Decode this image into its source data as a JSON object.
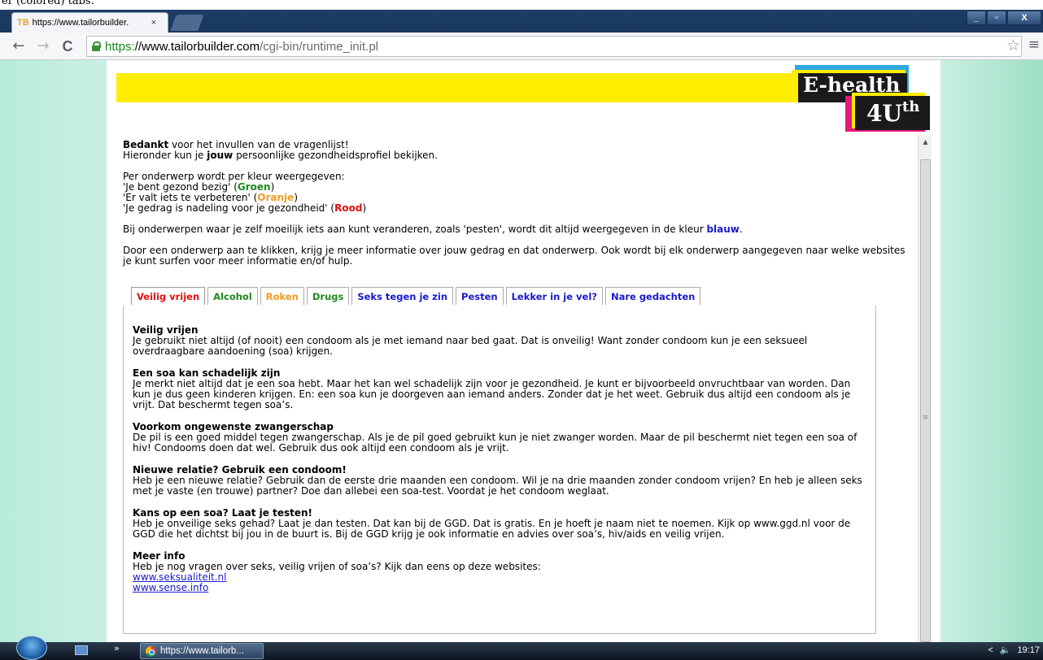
{
  "page_top_text": "er (colored) tabs.",
  "browser": {
    "tab_favicon": "TB",
    "tab_title": "https://www.tailorbuilder.",
    "tab_close": "×",
    "window_buttons": {
      "minimize": "_",
      "maximize": "▫",
      "close": "X"
    },
    "nav": {
      "back": "←",
      "forward": "→",
      "reload": "C"
    },
    "url": {
      "scheme": "https:",
      "host": "//www.tailorbuilder.com",
      "path": "/cgi-bin/runtime_init.pl"
    },
    "star": "☆",
    "menu": "≡"
  },
  "logo": {
    "line1": "E-health",
    "line2": "4U",
    "line2_sup": "th"
  },
  "intro": {
    "bedankt": "Bedankt",
    "line1_rest": " voor het invullen van de vragenlijst!",
    "line2_a": "Hieronder kun je ",
    "line2_bold": "jouw",
    "line2_b": " persoonlijke gezondheidsprofiel bekijken."
  },
  "legend": {
    "heading": "Per onderwerp wordt per kleur weergegeven:",
    "green_pre": "'Je bent gezond bezig' (",
    "green_word": "Groen",
    "orange_pre": "'Er valt iets te verbeteren' (",
    "orange_word": "Oranje",
    "red_pre": "'Je gedrag is nadeling voor je gezondheid' (",
    "red_word": "Rood",
    "close_paren": ")"
  },
  "blue_note": {
    "pre": "Bij onderwerpen waar je zelf moeilijk iets aan kunt veranderen, zoals 'pesten', wordt dit altijd weergegeven in de kleur ",
    "word": "blauw",
    "post": "."
  },
  "click_note": "Door een onderwerp aan te klikken, krijg je meer informatie over jouw gedrag en dat onderwerp. Ook wordt bij elk onderwerp aangegeven naar welke websites je kunt surfen voor meer informatie en/of hulp.",
  "topic_tabs": [
    {
      "label": "Veilig vrijen",
      "color": "#e01010"
    },
    {
      "label": "Alcohol",
      "color": "#1e8a1e"
    },
    {
      "label": "Roken",
      "color": "#f39a1e"
    },
    {
      "label": "Drugs",
      "color": "#1e8a1e"
    },
    {
      "label": "Seks tegen je zin",
      "color": "#1a1acc"
    },
    {
      "label": "Pesten",
      "color": "#1a1acc"
    },
    {
      "label": "Lekker in je vel?",
      "color": "#1a1acc"
    },
    {
      "label": "Nare gedachten",
      "color": "#1a1acc"
    }
  ],
  "sections": [
    {
      "title": "Veilig vrijen",
      "body": "Je gebruikt niet altijd (of nooit) een condoom als je met iemand naar bed gaat. Dat is onveilig! Want zonder condoom kun je een seksueel overdraagbare aandoening (soa) krijgen."
    },
    {
      "title": "Een soa kan schadelijk zijn",
      "body": "Je merkt niet altijd dat je een soa hebt. Maar het kan wel schadelijk zijn voor je gezondheid. Je kunt er bijvoorbeeld onvruchtbaar van worden. Dan kun je dus geen kinderen krijgen. En: een soa kun je doorgeven aan iemand anders. Zonder dat je het weet. Gebruik dus altijd een condoom als je vrijt. Dat beschermt tegen soa’s."
    },
    {
      "title": "Voorkom ongewenste zwangerschap",
      "body": "De pil is een goed middel tegen zwangerschap. Als je de pil goed gebruikt kun je niet zwanger worden. Maar de pil beschermt niet tegen een soa of hiv! Condooms doen dat wel. Gebruik dus ook altijd een condoom als je vrijt."
    },
    {
      "title": "Nieuwe relatie? Gebruik een condoom!",
      "body": "Heb je een nieuwe relatie? Gebruik dan de eerste drie maanden een condoom. Wil je na drie maanden zonder condoom vrijen? En heb je alleen seks met je vaste (en trouwe) partner? Doe dan allebei een soa-test. Voordat je het condoom weglaat."
    },
    {
      "title": "Kans op een soa? Laat je testen!",
      "body": "Heb je onveilige seks gehad? Laat je dan testen. Dat kan bij de GGD. Dat is gratis. En je hoeft je naam niet te noemen. Kijk op www.ggd.nl voor de GGD die het dichtst bij jou in de buurt is. Bij de GGD krijg je ook informatie en advies over soa’s, hiv/aids en veilig vrijen."
    }
  ],
  "meer_info": {
    "title": "Meer info",
    "body": "Heb je nog vragen over seks, veilig vrijen of soa’s? Kijk dan eens op deze websites:",
    "links": [
      "www.seksualiteit.nl",
      "www.sense.info"
    ]
  },
  "scrollbar": {
    "up": "▲",
    "grip": "≡"
  },
  "taskbar": {
    "more": "»",
    "task_label": "https://www.tailorb...",
    "tray_arrow": "<",
    "volume": "🔈",
    "time": "19:17"
  }
}
